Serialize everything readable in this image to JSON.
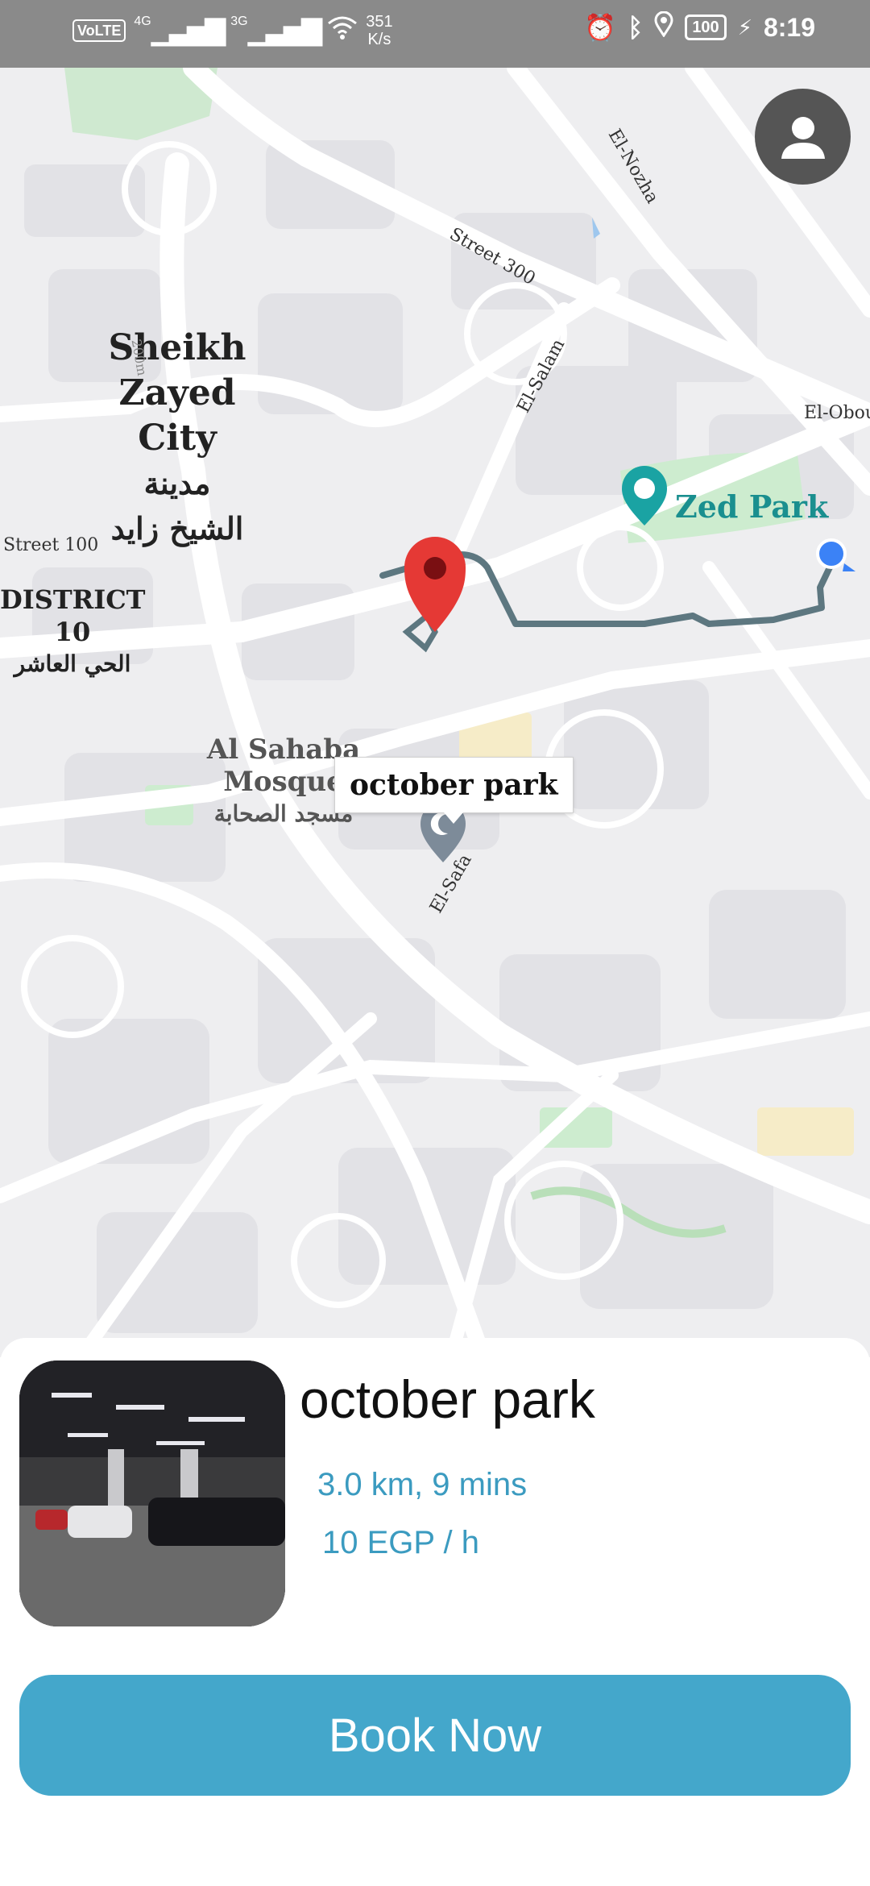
{
  "status_bar": {
    "volte": "VoLTE",
    "signal_1": "4G",
    "signal_2": "3G",
    "speed_value": "351",
    "speed_unit": "K/s",
    "battery": "100",
    "time": "8:19"
  },
  "map": {
    "city_name_en_1": "Sheikh",
    "city_name_en_2": "Zayed City",
    "city_name_ar_1": "مدينة",
    "city_name_ar_2": "الشيخ زايد",
    "district_en": "DISTRICT 10",
    "district_ar": "الحي العاشر",
    "park_label": "Zed Park",
    "mosque_en": "Al Sahaba Mosque",
    "mosque_ar": "مسجد الصحابة",
    "roads": {
      "el_nozha": "El-Nozha",
      "street_300": "Street 300",
      "el_salam": "El-Salam",
      "el_obour": "El-Obour",
      "street_100": "Street 100",
      "el_safa": "El-Safa",
      "contour": "200m"
    },
    "marker_callout": "october park",
    "colors": {
      "route": "#5d7780",
      "marker": "#e53935",
      "user_dot": "#3b82f6",
      "park": "#cdeccf",
      "park_pin": "#1aa3a3"
    }
  },
  "card": {
    "title": "october park",
    "distance": "3.0 km, 9 mins",
    "price": "10 EGP / h",
    "book_button": "Book Now"
  }
}
